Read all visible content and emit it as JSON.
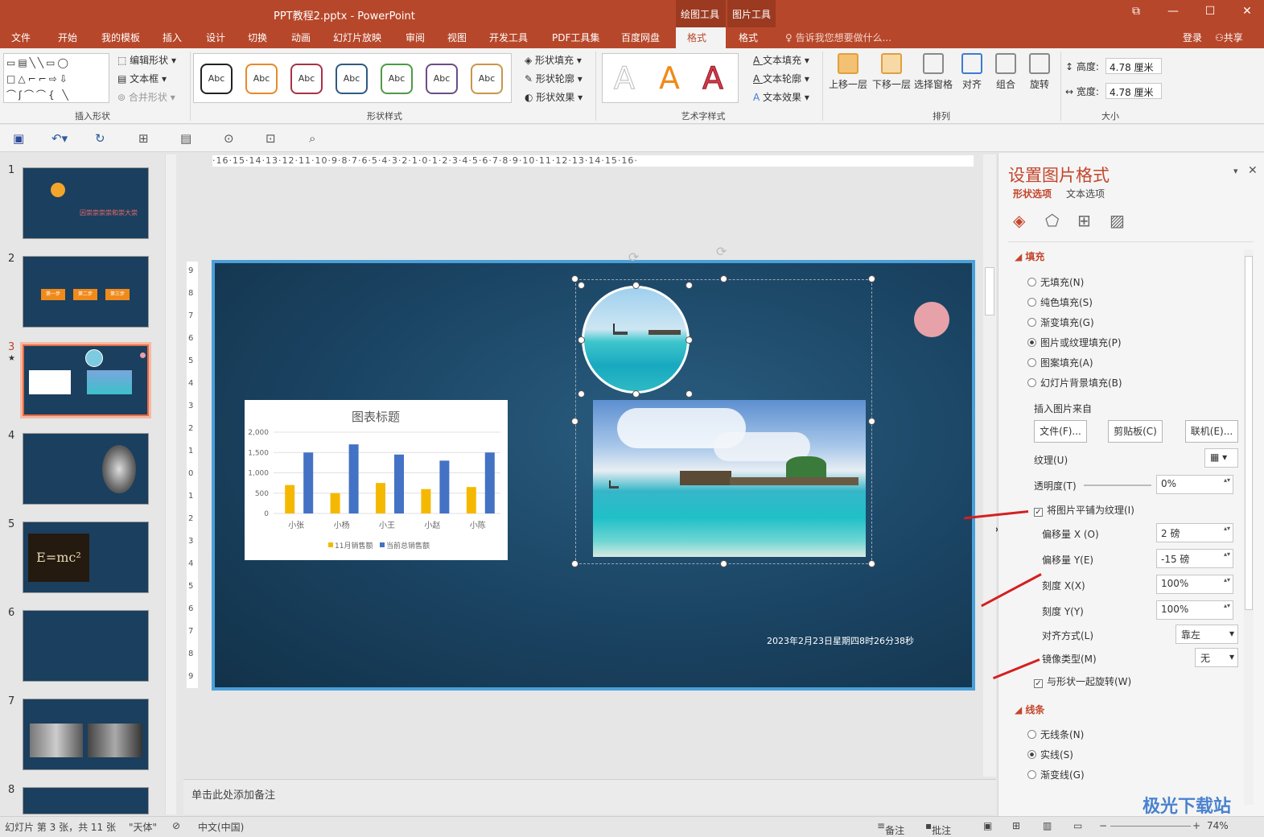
{
  "window": {
    "title": "PPT教程2.pptx - PowerPoint",
    "ctx_draw": "绘图工具",
    "ctx_pic": "图片工具"
  },
  "menu": {
    "tabs": [
      "文件",
      "开始",
      "我的模板",
      "插入",
      "设计",
      "切换",
      "动画",
      "幻灯片放映",
      "审阅",
      "视图",
      "开发工具",
      "PDF工具集",
      "百度网盘",
      "格式",
      "格式"
    ],
    "tellme": "告诉我您想要做什么...",
    "login": "登录",
    "share": "共享"
  },
  "ribbon": {
    "insert_shapes": {
      "edit_shape": "编辑形状",
      "textbox": "文本框",
      "merge": "合并形状",
      "label": "插入形状"
    },
    "shape_styles": {
      "abc": [
        "Abc",
        "Abc",
        "Abc",
        "Abc",
        "Abc",
        "Abc",
        "Abc"
      ],
      "abc_colors": [
        "#222222",
        "#e8892a",
        "#a83245",
        "#2e5a84",
        "#4e9a45",
        "#6a4d8a",
        "#c8964a"
      ],
      "fill": "形状填充",
      "outline": "形状轮廓",
      "effect": "形状效果",
      "label": "形状样式"
    },
    "wordart": {
      "letters": [
        "A",
        "A",
        "A"
      ],
      "text_fill": "文本填充",
      "text_outline": "文本轮廓",
      "text_effect": "文本效果",
      "label": "艺术字样式"
    },
    "arrange": {
      "bring_forward": "上移一层",
      "send_backward": "下移一层",
      "selection_pane": "选择窗格",
      "align": "对齐",
      "group": "组合",
      "rotate": "旋转",
      "label": "排列"
    },
    "size": {
      "height_label": "高度:",
      "height": "4.78 厘米",
      "width_label": "宽度:",
      "width": "4.78 厘米",
      "label": "大小"
    }
  },
  "slides": {
    "numbers": [
      "1",
      "2",
      "3",
      "4",
      "5",
      "6",
      "7",
      "8"
    ],
    "star": "★",
    "t1": "因崇崇崇崇和崇大崇",
    "t2_steps": [
      "第一步",
      "第二步",
      "第三步"
    ],
    "t5_formula": "E=mc²"
  },
  "ruler": {
    "h": "·16·15·14·13·12·11·10·9·8·7·6·5·4·3·2·1·0·1·2·3·4·5·6·7·8·9·10·11·12·13·14·15·16·",
    "v": [
      "9",
      "8",
      "7",
      "6",
      "5",
      "4",
      "3",
      "2",
      "1",
      "0",
      "1",
      "2",
      "3",
      "4",
      "5",
      "6",
      "7",
      "8",
      "9"
    ]
  },
  "chart_data": {
    "type": "bar",
    "title": "图表标题",
    "categories": [
      "小张",
      "小杨",
      "小王",
      "小赵",
      "小陈"
    ],
    "series": [
      {
        "name": "11月销售额",
        "values": [
          700,
          500,
          750,
          600,
          650
        ],
        "color": "#f5b800"
      },
      {
        "name": "当前总销售额",
        "values": [
          1500,
          1700,
          1450,
          1300,
          1500
        ],
        "color": "#4472c4"
      }
    ],
    "yticks": [
      "2,000",
      "1,500",
      "1,000",
      "500",
      "0"
    ],
    "ylim": [
      0,
      2000
    ],
    "legend": "bottom"
  },
  "slide_date": "2023年2月23日星期四8时26分38秒",
  "notes": "单击此处添加备注",
  "pane": {
    "title": "设置图片格式",
    "tab_shape": "形状选项",
    "tab_text": "文本选项",
    "fill": {
      "header": "填充",
      "options": [
        "无填充(N)",
        "纯色填充(S)",
        "渐变填充(G)",
        "图片或纹理填充(P)",
        "图案填充(A)",
        "幻灯片背景填充(B)"
      ],
      "selected": 3,
      "insert_from": "插入图片来自",
      "btn_file": "文件(F)...",
      "btn_clip": "剪贴板(C)",
      "btn_online": "联机(E)...",
      "texture": "纹理(U)",
      "transparency": "透明度(T)",
      "transparency_val": "0%",
      "tile": "将图片平铺为纹理(I)",
      "offset_x": "偏移量 X (O)",
      "offset_x_val": "2 磅",
      "offset_y": "偏移量 Y(E)",
      "offset_y_val": "-15 磅",
      "scale_x": "刻度 X(X)",
      "scale_x_val": "100%",
      "scale_y": "刻度 Y(Y)",
      "scale_y_val": "100%",
      "align": "对齐方式(L)",
      "align_val": "靠左",
      "mirror": "镜像类型(M)",
      "mirror_val": "无",
      "rotate_with": "与形状一起旋转(W)"
    },
    "line": {
      "header": "线条",
      "options": [
        "无线条(N)",
        "实线(S)",
        "渐变线(G)"
      ],
      "selected": 1
    }
  },
  "status": {
    "slide": "幻灯片 第 3 张，共 11 张",
    "theme": "\"天体\"",
    "lang": "中文(中国)",
    "notes": "备注",
    "comments": "批注",
    "zoom": "74%"
  },
  "watermark": "极光下载站"
}
